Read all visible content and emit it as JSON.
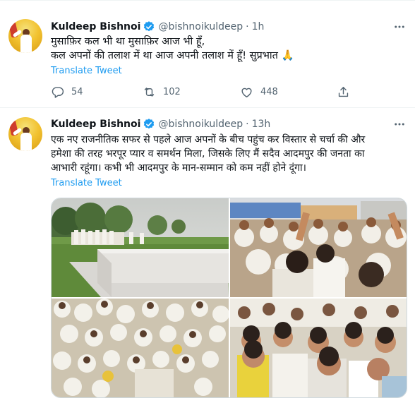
{
  "tweets": [
    {
      "name": "Kuldeep Bishnoi",
      "handle": "@bishnoikuldeep",
      "separator": "·",
      "time": "1h",
      "line1": "मुसाफ़िर कल भी था मुसाफ़िर आज भी हूँ,",
      "line2": "कल अपनों की तलाश में था आज अपनी तलाश में हूँ! सुप्रभात 🙏",
      "translate": "Translate Tweet",
      "replies": "54",
      "retweets": "102",
      "likes": "448"
    },
    {
      "name": "Kuldeep Bishnoi",
      "handle": "@bishnoikuldeep",
      "separator": "·",
      "time": "13h",
      "line1": "एक नए राजनीतिक सफर से पहले आज अपनों के बीच पहुंच कर विस्तार से चर्चा की और",
      "line2": "हमेशा की तरह भरपूर प्यार व समर्थन मिला, जिसके लिए मैं सदैव आदमपुर की जनता का",
      "line3": "आभारी रहूंगा। कभी भी आदमपुर के मान-सम्मान को कम नहीं होने दूंगा।",
      "translate": "Translate Tweet"
    }
  ],
  "icons": {
    "verified": "verified-badge-icon",
    "more": "more-icon",
    "reply": "reply-icon",
    "retweet": "retweet-icon",
    "like": "like-icon",
    "share": "share-icon"
  },
  "colors": {
    "accent": "#1d9bf0",
    "secondary_text": "#536471"
  }
}
